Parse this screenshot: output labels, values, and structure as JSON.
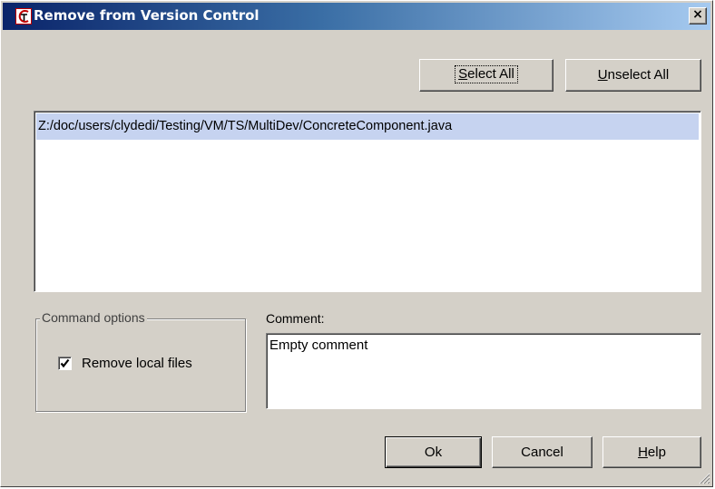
{
  "window": {
    "title": "Remove from Version Control",
    "close_symbol": "×"
  },
  "buttons": {
    "select_all": {
      "pre": "",
      "mnemonic": "S",
      "post": "elect All"
    },
    "unselect_all": {
      "pre": "",
      "mnemonic": "U",
      "post": "nselect All"
    },
    "ok": "Ok",
    "cancel": "Cancel",
    "help": {
      "pre": "",
      "mnemonic": "H",
      "post": "elp"
    }
  },
  "file_list": {
    "items": [
      {
        "path": "Z:/doc/users/clydedi/Testing/VM/TS/MultiDev/ConcreteComponent.java",
        "selected": true
      }
    ]
  },
  "command_options": {
    "legend": "Command options",
    "remove_local_files": {
      "label": "Remove local files",
      "checked": true
    }
  },
  "comment": {
    "label": "Comment:",
    "value": "Empty comment"
  },
  "icons": {
    "app": "app-logo-icon",
    "close": "close-icon",
    "check": "checkmark-icon",
    "grip": "resize-grip-icon"
  },
  "colors": {
    "title_gradient_start": "#0a246a",
    "title_gradient_end": "#a6caf0",
    "face": "#d4d0c8",
    "selection": "#c6d3f0"
  }
}
